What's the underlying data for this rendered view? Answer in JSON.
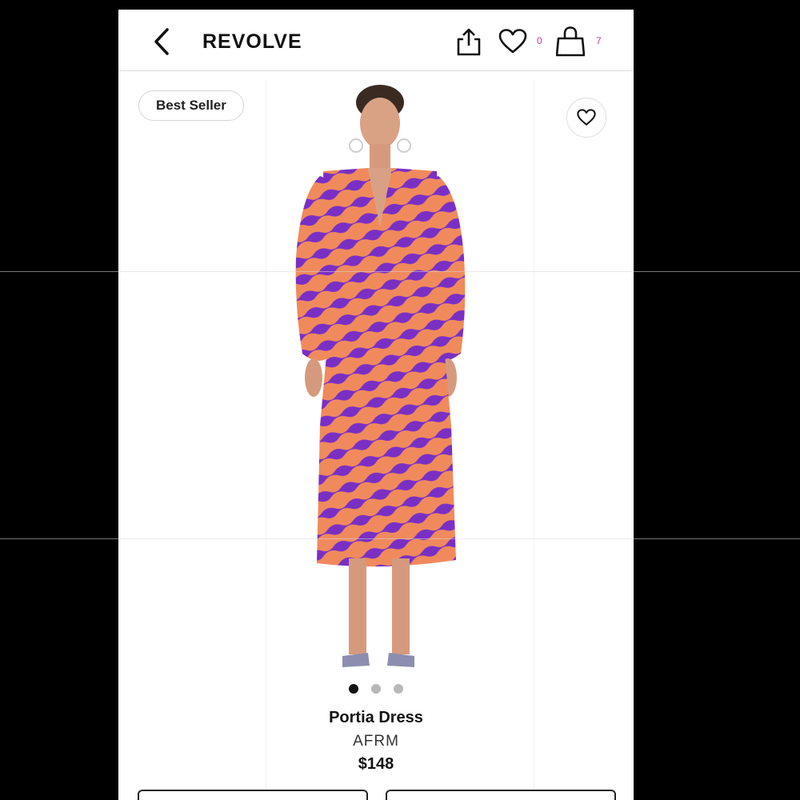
{
  "header": {
    "brand": "REVOLVE",
    "wishlist_count": "0",
    "cart_count": "7",
    "icons": [
      "back-chevron-icon",
      "share-icon",
      "heart-icon",
      "shopping-bag-icon"
    ]
  },
  "product": {
    "badge": "Best Seller",
    "name": "Portia Dress",
    "designer": "AFRM",
    "price": "$148",
    "image_count": 3,
    "active_image": 1
  },
  "colors": {
    "accent_count": "#c2369a",
    "dress_orange": "#f08a5d",
    "dress_purple": "#7a2fc4"
  }
}
